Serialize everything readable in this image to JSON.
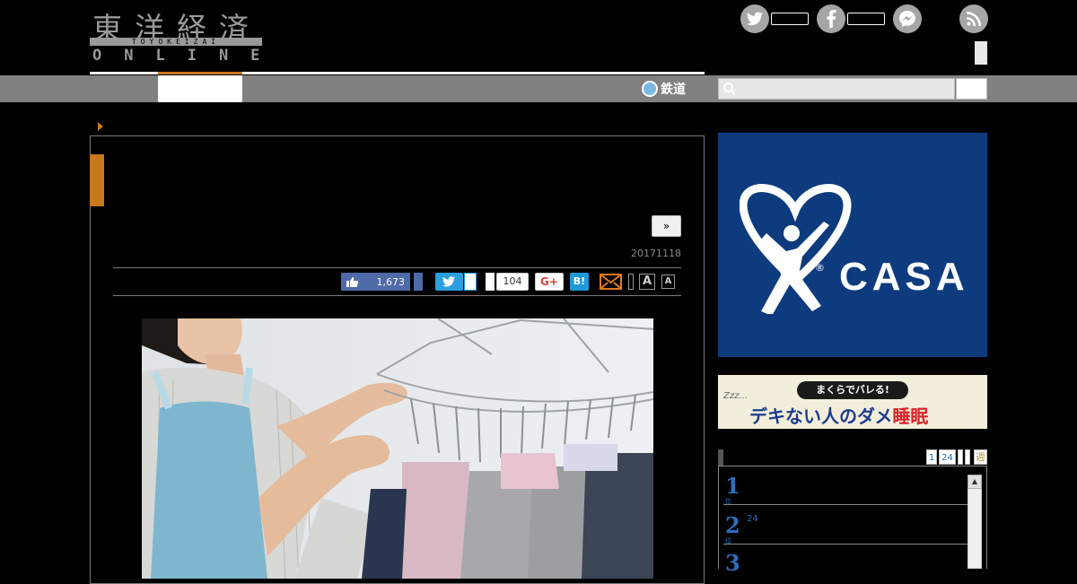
{
  "header": {
    "logo_kanji": "東洋経済",
    "logo_sub": "TOYOKEIZAI",
    "logo_online": "ONLINE",
    "social": [
      {
        "icon": "twitter-icon",
        "glyph": "t"
      },
      {
        "icon": "facebook-icon",
        "glyph": "f"
      },
      {
        "icon": "messenger-icon",
        "glyph": "~"
      },
      {
        "icon": "rss-icon",
        "glyph": ")"
      }
    ]
  },
  "nav": {
    "rail_label": "鉄道",
    "search_placeholder": ""
  },
  "article": {
    "next_label": "»",
    "date": "20171118",
    "share": {
      "like_count": "1,673",
      "hatena_count": "104",
      "gplus_label": "G+",
      "hatena_label": "B!",
      "font_large": "A",
      "font_small": "A"
    }
  },
  "sidebar": {
    "casa_ad_text": "CASA",
    "casa_reg": "®",
    "sleep_ad_top": "まくらでバレる!",
    "sleep_ad_main_a": "デキない人のダメ",
    "sleep_ad_main_b": "睡眠",
    "sleep_ad_zzz": "Zzz…",
    "ranking_tabs": [
      "1",
      "24",
      "",
      "",
      "週"
    ],
    "ranking": [
      {
        "rank": "1",
        "suffix": "位",
        "text": ""
      },
      {
        "rank": "2",
        "suffix": "位",
        "text": "24"
      },
      {
        "rank": "3",
        "suffix": "位",
        "text": ""
      }
    ],
    "scroll_up": "▲"
  },
  "colors": {
    "accent": "#c8781e",
    "nav": "#808080",
    "casa_blue": "#0e3b7d",
    "facebook": "#4f6aa8",
    "twitter": "#2c9fe0",
    "hatena": "#1f9ad6",
    "rank_blue": "#2b6fbf"
  }
}
